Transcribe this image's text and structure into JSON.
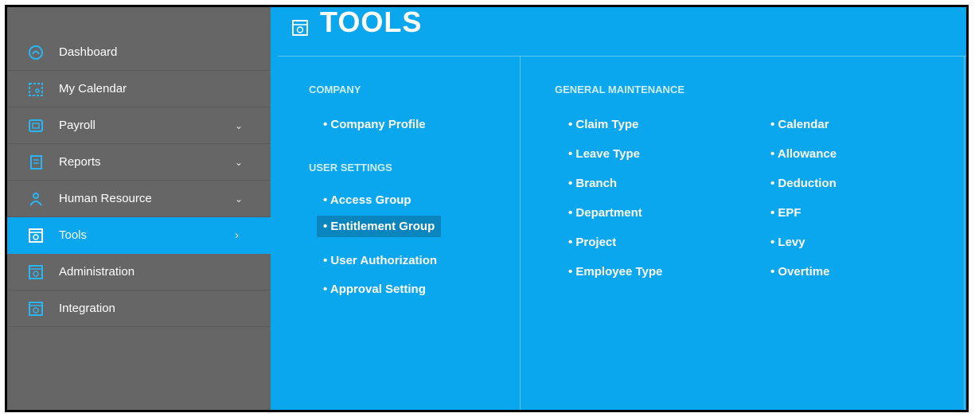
{
  "sidebar": {
    "items": [
      {
        "label": "Dashboard",
        "icon": "gauge-icon",
        "chevron": ""
      },
      {
        "label": "My Calendar",
        "icon": "calendar-icon",
        "chevron": ""
      },
      {
        "label": "Payroll",
        "icon": "payroll-icon",
        "chevron": "⌄"
      },
      {
        "label": "Reports",
        "icon": "report-icon",
        "chevron": "⌄"
      },
      {
        "label": "Human Resource",
        "icon": "people-icon",
        "chevron": "⌄"
      },
      {
        "label": "Tools",
        "icon": "tools-icon",
        "chevron": "›"
      },
      {
        "label": "Administration",
        "icon": "admin-icon",
        "chevron": ""
      },
      {
        "label": "Integration",
        "icon": "integration-icon",
        "chevron": ""
      }
    ],
    "active_index": 5
  },
  "panel": {
    "title": "TOOLS",
    "company": {
      "heading": "COMPANY",
      "links": [
        "• Company Profile"
      ]
    },
    "user_settings": {
      "heading": "USER SETTINGS",
      "links": [
        "• Access Group",
        "• Entitlement Group",
        "• User Authorization",
        "• Approval Setting"
      ],
      "highlighted": "• Entitlement Group"
    },
    "general_maintenance": {
      "heading": "GENERAL MAINTENANCE",
      "col1": [
        "• Claim Type",
        "• Leave Type",
        "• Branch",
        "• Department",
        "• Project",
        "• Employee Type"
      ],
      "col2": [
        "• Calendar",
        "• Allowance",
        "• Deduction",
        "• EPF",
        "• Levy",
        "• Overtime"
      ]
    }
  },
  "colors": {
    "sidebar": "#666666",
    "accent": "#0aa6ee",
    "highlight": "#0b85bd"
  }
}
